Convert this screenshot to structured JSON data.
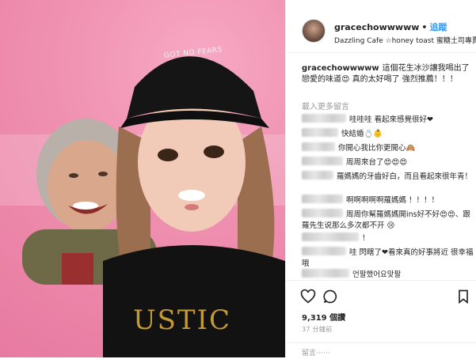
{
  "photo": {
    "cap_text": "GOT NO FEARS",
    "shirt_text": "USTIC"
  },
  "header": {
    "username": "gracechowwwww",
    "separator": "•",
    "follow_label": "追蹤",
    "location": "Dazzling Cafe ☆honey toast 蜜糖土司專賣..."
  },
  "caption": {
    "username": "gracechowwwww",
    "text": "這個花生冰沙讓我喝出了戀愛的味道😍 真的太好喝了 強烈推薦！！！"
  },
  "load_more_label": "載入更多留言",
  "comments": [
    {
      "text": "哇哇哇 看起來感覺很好❤"
    },
    {
      "text": "快結婚💍👶"
    },
    {
      "text": "你開心我比你更開心🙈"
    },
    {
      "text": "周周來台了😍😍😍"
    },
    {
      "text": "羅媽媽的牙齒好白，而且看起來很年青！"
    },
    {
      "text": "啊啊啊啊啊羅媽媽 ！！！！"
    },
    {
      "text": "周周你幫羅媽媽開ins好不好😍😍、跟羅先生说那么多次都不开 😢"
    },
    {
      "text": "！"
    },
    {
      "text": "哇 閃瞎了❤看來真的好事將近 很幸福哦"
    },
    {
      "text": "언팔했어요맞팔"
    }
  ],
  "actions": {
    "likes": "9,319 個讚",
    "time": "37 分鐘前",
    "add_comment_placeholder": "留言⋯⋯"
  },
  "colors": {
    "follow": "#3897f0",
    "photo_bg": "#f091b1",
    "muted": "#999999"
  },
  "icons": [
    "heart-icon",
    "comment-icon",
    "bookmark-icon"
  ]
}
